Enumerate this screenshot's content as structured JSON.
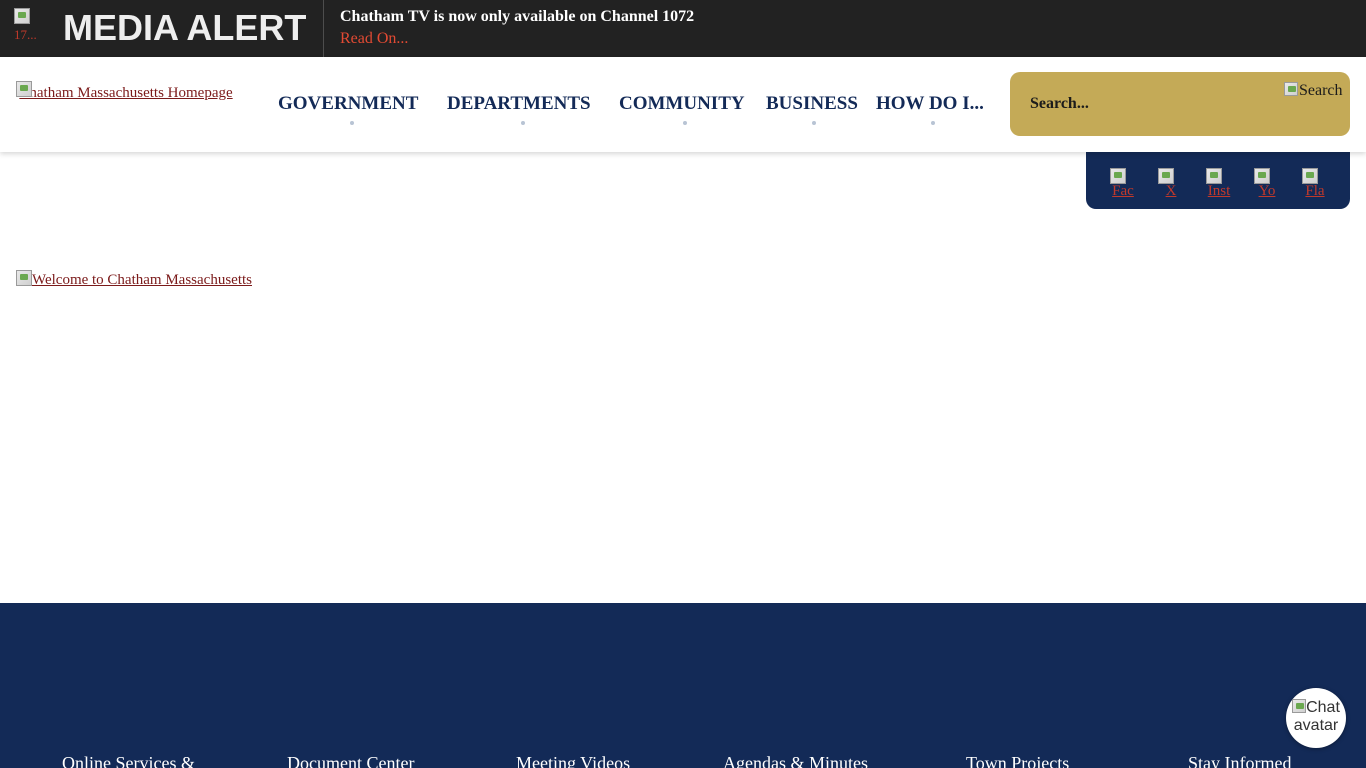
{
  "alert": {
    "image_alt": "17...",
    "title": "MEDIA ALERT",
    "message": "Chatham TV is now only available on Channel 1072",
    "read_on": "Read On..."
  },
  "header": {
    "logo_alt": "Chatham Massachusetts Homepage",
    "nav": [
      {
        "label": "GOVERNMENT"
      },
      {
        "label": "DEPARTMENTS"
      },
      {
        "label": "COMMUNITY"
      },
      {
        "label": "BUSINESS"
      },
      {
        "label": "HOW DO I..."
      }
    ],
    "search": {
      "placeholder": "Search...",
      "button_alt": "Search"
    }
  },
  "social": {
    "links": [
      {
        "alt": "Fac",
        "icon": "facebook-icon"
      },
      {
        "alt": "X",
        "icon": "x-icon"
      },
      {
        "alt": "Inst",
        "icon": "instagram-icon"
      },
      {
        "alt": "Yo",
        "icon": "youtube-icon"
      },
      {
        "alt": "Fla",
        "icon": "flag-icon"
      }
    ]
  },
  "main": {
    "welcome_alt": "Welcome to Chatham Massachusetts"
  },
  "footer": {
    "links": [
      {
        "label": "Online Services &"
      },
      {
        "label": "Document Center"
      },
      {
        "label": "Meeting Videos"
      },
      {
        "label": "Agendas & Minutes"
      },
      {
        "label": "Town Projects"
      },
      {
        "label": "Stay Informed"
      }
    ]
  },
  "chat": {
    "alt": "Chat avatar"
  },
  "colors": {
    "alert_bg": "#222222",
    "navy": "#132a57",
    "gold": "#c4aa57",
    "link_red": "#7b1a1a",
    "alert_accent": "#e24a33"
  }
}
